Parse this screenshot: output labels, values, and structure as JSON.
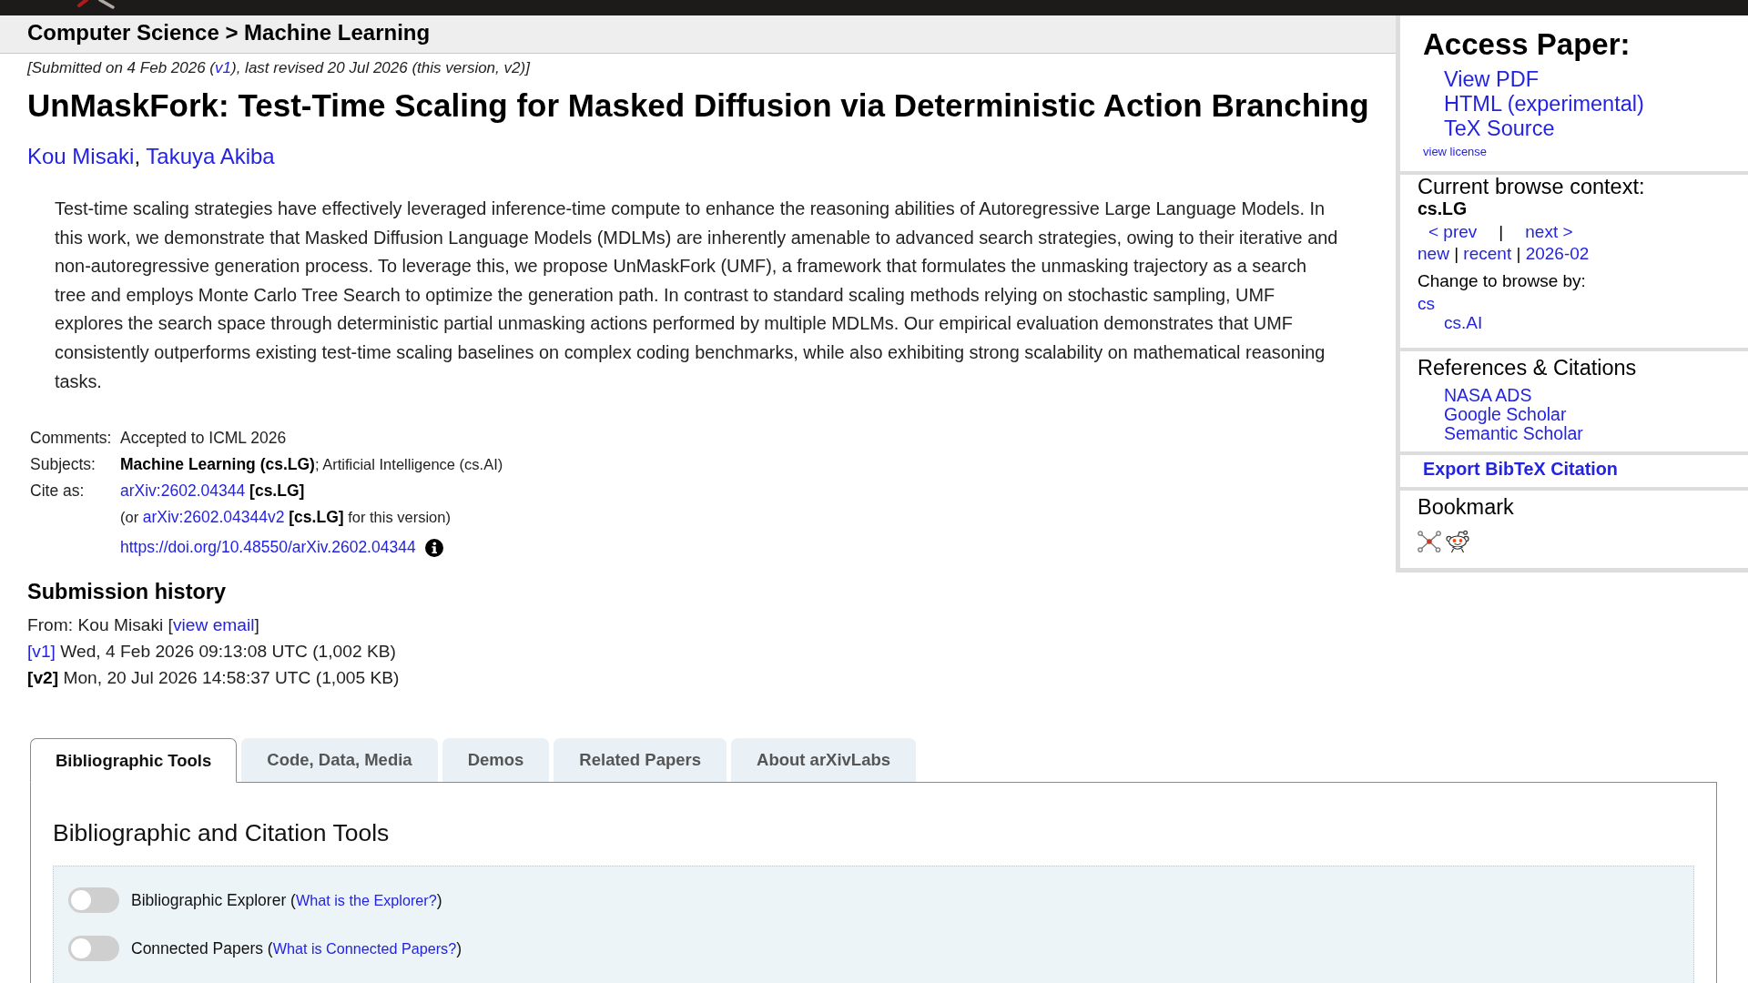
{
  "breadcrumb": "Computer Science > Machine Learning",
  "paper": {
    "dateline": {
      "before": "[Submitted on 4 Feb 2026 (",
      "link": "v1",
      "after": "), last revised 20 Jul 2026 (this version, v2)]"
    },
    "title": "UnMaskFork: Test-Time Scaling for Masked Diffusion via Deterministic Action Branching",
    "authors": {
      "names": [
        "Kou Misaki",
        "Takuya Akiba"
      ],
      "separator": ", "
    },
    "abstract": "Test-time scaling strategies have effectively leveraged inference-time compute to enhance the reasoning abilities of Autoregressive Large Language Models. In this work, we demonstrate that Masked Diffusion Language Models (MDLMs) are inherently amenable to advanced search strategies, owing to their iterative and non-autoregressive generation process. To leverage this, we propose UnMaskFork (UMF), a framework that formulates the unmasking trajectory as a search tree and employs Monte Carlo Tree Search to optimize the generation path. In contrast to standard scaling methods relying on stochastic sampling, UMF explores the search space through deterministic partial unmasking actions performed by multiple MDLMs. Our empirical evaluation demonstrates that UMF consistently outperforms existing test-time scaling baselines on complex coding benchmarks, while also exhibiting strong scalability on mathematical reasoning tasks.",
    "metadata": [
      {
        "label": "Comments:",
        "lines": [
          {
            "segments": [
              {
                "kind": "text",
                "text": "Accepted to ICML 2026"
              }
            ]
          }
        ]
      },
      {
        "label": "Subjects:",
        "lines": [
          {
            "segments": [
              {
                "kind": "primary",
                "text": "Machine Learning (cs.LG)"
              },
              {
                "kind": "secondary",
                "text": "; Artificial Intelligence (cs.AI)"
              }
            ]
          }
        ]
      },
      {
        "label": "Cite as:",
        "lines": [
          {
            "segments": [
              {
                "kind": "link",
                "text": "arXiv:2602.04344"
              },
              {
                "kind": "bold",
                "text": " [cs.LG]"
              }
            ]
          },
          {
            "segments": [
              {
                "kind": "secondary",
                "text": "(or "
              },
              {
                "kind": "link",
                "text": "arXiv:2602.04344v2"
              },
              {
                "kind": "bold",
                "text": " [cs.LG]"
              },
              {
                "kind": "secondary",
                "text": " for this version)"
              }
            ]
          },
          {
            "segments": [
              {
                "kind": "link",
                "text": "https://doi.org/10.48550/arXiv.2602.04344"
              }
            ],
            "info_icon": true
          }
        ]
      }
    ]
  },
  "submission_history": {
    "heading": "Submission history",
    "from": {
      "before": "From: Kou Misaki [",
      "link": "view email",
      "after": "]"
    },
    "versions": [
      {
        "label": "[v1]",
        "current": false,
        "detail": " Wed, 4 Feb 2026 09:13:08 UTC (1,002 KB)"
      },
      {
        "label": "[v2]",
        "current": true,
        "detail": " Mon, 20 Jul 2026 14:58:37 UTC (1,005 KB)"
      }
    ]
  },
  "sidebar": {
    "access_paper": {
      "heading": "Access Paper:",
      "links": [
        "View PDF",
        "HTML (experimental)",
        "TeX Source"
      ],
      "license": "view license"
    },
    "browse_context": {
      "heading": "Current browse context:",
      "category": "cs.LG",
      "navigation": [
        {
          "kind": "link",
          "text": "< prev"
        },
        {
          "kind": "text",
          "text": "|"
        },
        {
          "kind": "link",
          "text": "next >"
        }
      ],
      "listings": [
        {
          "kind": "link",
          "text": "new"
        },
        {
          "kind": "text",
          "text": " | "
        },
        {
          "kind": "link",
          "text": "recent"
        },
        {
          "kind": "text",
          "text": " | "
        },
        {
          "kind": "link",
          "text": "2026-02"
        }
      ],
      "change_label": "Change to browse by:",
      "categories": [
        {
          "label": "cs",
          "children": [
            {
              "label": "cs.AI"
            }
          ]
        }
      ]
    },
    "references": {
      "heading": "References & Citations",
      "links": [
        "NASA ADS",
        "Google Scholar",
        "Semantic Scholar"
      ]
    },
    "export": "Export BibTeX Citation",
    "bookmark": {
      "heading": "Bookmark"
    }
  },
  "labs": {
    "tabs": [
      {
        "label": "Bibliographic Tools",
        "selected": true
      },
      {
        "label": "Code, Data, Media",
        "selected": false
      },
      {
        "label": "Demos",
        "selected": false
      },
      {
        "label": "Related Papers",
        "selected": false
      },
      {
        "label": "About arXivLabs",
        "selected": false
      }
    ],
    "panel": {
      "heading": "Bibliographic and Citation Tools",
      "toggles": [
        {
          "before": "Bibliographic Explorer (",
          "link": "What is the Explorer?",
          "after": ")",
          "on": false
        },
        {
          "before": "Connected Papers (",
          "link": "What is Connected Papers?",
          "after": ")",
          "on": false
        }
      ]
    }
  }
}
